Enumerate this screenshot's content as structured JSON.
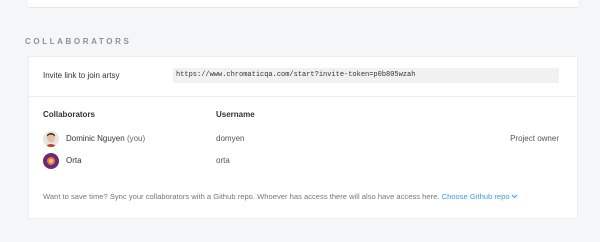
{
  "section_title": "COLLABORATORS",
  "invite": {
    "label": "Invite link to join artsy",
    "link": "https://www.chromaticqa.com/start?invite-token=p0b805wzah"
  },
  "table": {
    "headers": [
      "Collaborators",
      "Username"
    ],
    "rows": [
      {
        "name": "Dominic Nguyen",
        "suffix": "(you)",
        "username": "domyen",
        "role": "Project owner"
      },
      {
        "name": "Orta",
        "suffix": "",
        "username": "orta",
        "role": ""
      }
    ]
  },
  "footer": {
    "text": "Want to save time? Sync your collaborators with a Github repo. Whoever has access there will also have access here.",
    "link": "Choose Github repo",
    "link_icon": "chevron-down-icon"
  },
  "colors": {
    "accent_link": "#3aa0e0",
    "avatar_orta": "#6a2a7a"
  }
}
